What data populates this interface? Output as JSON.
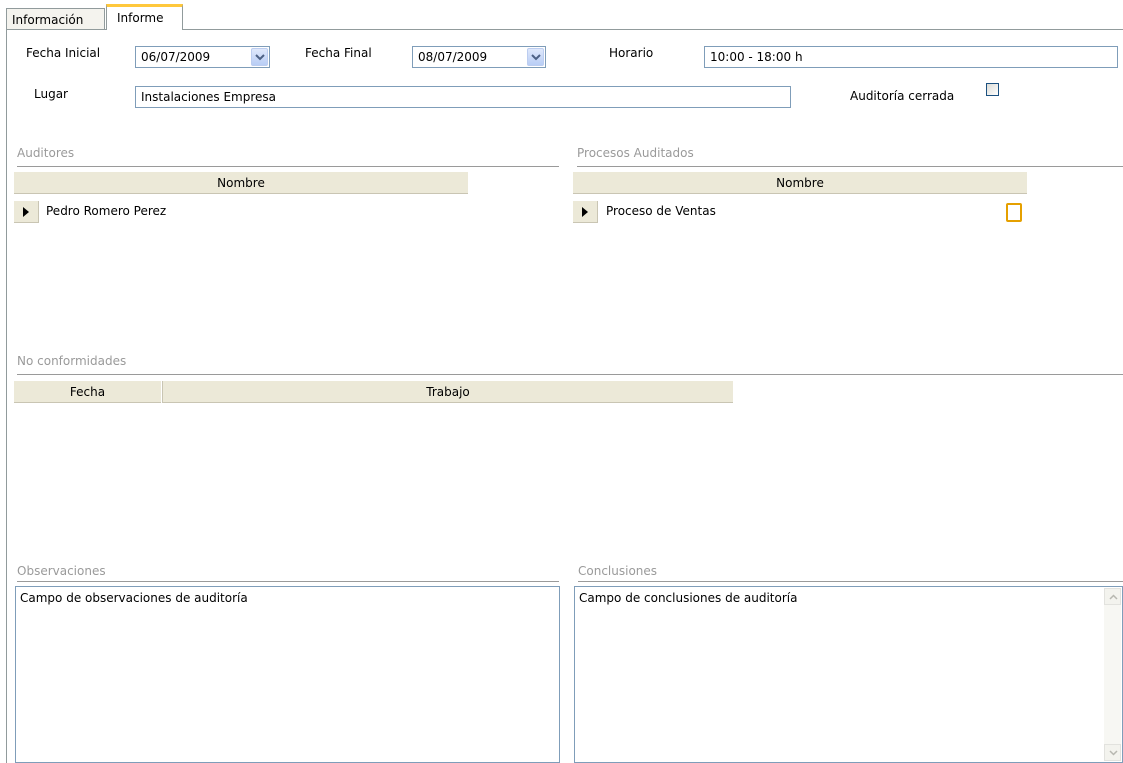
{
  "tabs": [
    {
      "label": "Información"
    },
    {
      "label": "Informe"
    }
  ],
  "form": {
    "fecha_inicial_label": "Fecha Inicial",
    "fecha_inicial_value": "06/07/2009",
    "fecha_final_label": "Fecha Final",
    "fecha_final_value": "08/07/2009",
    "horario_label": "Horario",
    "horario_value": "10:00 - 18:00 h",
    "lugar_label": "Lugar",
    "lugar_value": "Instalaciones Empresa",
    "auditoria_cerrada_label": "Auditoría cerrada",
    "auditoria_cerrada_checked": false
  },
  "auditores": {
    "title": "Auditores",
    "header": "Nombre",
    "rows": [
      {
        "nombre": "Pedro Romero Perez"
      }
    ]
  },
  "procesos": {
    "title": "Procesos Auditados",
    "header": "Nombre",
    "rows": [
      {
        "nombre": "Proceso de Ventas"
      }
    ]
  },
  "no_conformidades": {
    "title": "No conformidades",
    "headers": [
      "Fecha",
      "Trabajo"
    ],
    "rows": []
  },
  "observaciones": {
    "title": "Observaciones",
    "value": "Campo de observaciones de auditoría"
  },
  "conclusiones": {
    "title": "Conclusiones",
    "value": "Campo de conclusiones de auditoría"
  },
  "icons": {
    "dropdown": "chevron-down-icon",
    "row_pointer": "triangle-right-icon",
    "scroll_up": "chevron-up-icon",
    "scroll_down": "chevron-down-icon"
  },
  "colors": {
    "active_tab_accent": "#ffc83c",
    "border": "#7f9db9",
    "grid_header": "#ece9d8",
    "section_title": "#9a9a9a"
  }
}
